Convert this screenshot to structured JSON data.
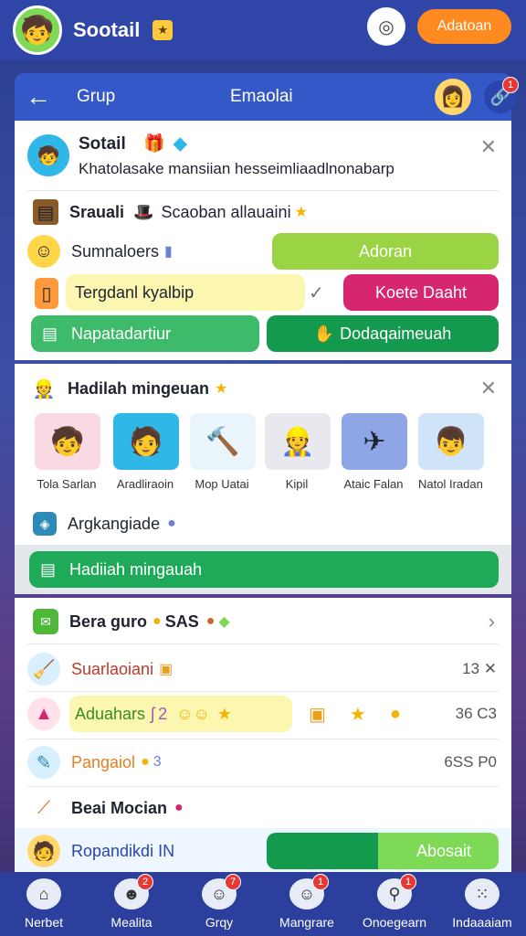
{
  "app": {
    "title": "Sootail",
    "primary_button": "Adatoan"
  },
  "header": {
    "tab": "Grup",
    "title": "Emaolai",
    "link_badge": "1"
  },
  "profile": {
    "name": "Sotail",
    "message": "Khatolasake mansiian hesseimliaadlnonabarp"
  },
  "item_row": {
    "label": "Srauali",
    "detail": "Scaoban allauaini"
  },
  "summary_row": {
    "label": "Sumnaloers",
    "button": "Adoran"
  },
  "input_row": {
    "placeholder_text": "Tergdanl kyalbip",
    "button": "Koete Daaht"
  },
  "action_row": {
    "left_button": "Napatadartiur",
    "right_button": "Dodaqaimeuah"
  },
  "weekly": {
    "title": "Hadilah mingeuan",
    "rewards": [
      {
        "label": "Tola Sarlan",
        "icon": "boy-avatar-icon",
        "bg": "#f9d9e4",
        "glyph": "🧒"
      },
      {
        "label": "Aradliraoin",
        "icon": "player-avatar-icon",
        "bg": "#2fb7e8",
        "glyph": "🧑"
      },
      {
        "label": "Mop Uatai",
        "icon": "hammer-icon",
        "bg": "#e9f4fb",
        "glyph": "🔨"
      },
      {
        "label": "Kipil",
        "icon": "worker-avatar-icon",
        "bg": "#e7e9ee",
        "glyph": "👷"
      },
      {
        "label": "Ataic Falan",
        "icon": "plane-icon",
        "bg": "#8fa6e6",
        "glyph": "✈"
      },
      {
        "label": "Natol Iradan",
        "icon": "kid-avatar-icon",
        "bg": "#cfe4f8",
        "glyph": "👦"
      }
    ],
    "sub_label": "Argkangiade",
    "claim_button": "Hadiiah mingauah"
  },
  "list": {
    "row1": {
      "label": "Bera guro",
      "value": "SAS"
    },
    "row2": {
      "label": "Suarlaoiani",
      "value": "13"
    },
    "row3": {
      "label": "Aduahars",
      "suffix": "2",
      "value": "36 C3"
    },
    "row4": {
      "label": "Pangaiol",
      "suffix": "3",
      "value": "6SS P0"
    },
    "row5": {
      "label": "Beai Mocian"
    },
    "row6": {
      "label": "Ropandikdi IN",
      "button": "Abosait"
    }
  },
  "nav": [
    {
      "label": "Nerbet",
      "icon": "home-icon",
      "glyph": "⌂",
      "badge": ""
    },
    {
      "label": "Mealita",
      "icon": "ghost-icon",
      "glyph": "☻",
      "badge": "2"
    },
    {
      "label": "Grqy",
      "icon": "group-icon",
      "glyph": "☺",
      "badge": "7"
    },
    {
      "label": "Mangrare",
      "icon": "face-icon",
      "glyph": "☺",
      "badge": "1"
    },
    {
      "label": "Onoegearn",
      "icon": "search-icon",
      "glyph": "⚲",
      "badge": "1"
    },
    {
      "label": "Indaaaiam",
      "icon": "menu-dots-icon",
      "glyph": "⁙",
      "badge": ""
    }
  ],
  "colors": {
    "brand": "#2f45a8",
    "accent": "#ff8a1f",
    "green": "#1faa59",
    "pink": "#d6266f"
  }
}
